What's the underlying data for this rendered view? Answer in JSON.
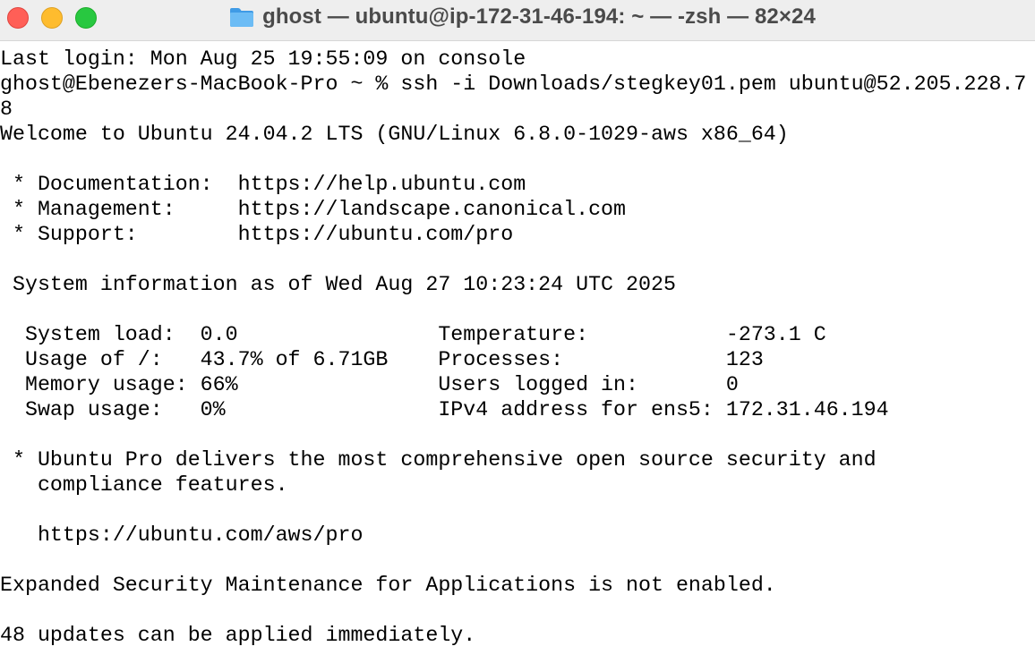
{
  "window": {
    "title": "ghost — ubuntu@ip-172-31-46-194: ~ — -zsh — 82×24",
    "icon": "folder-icon",
    "colors": {
      "close": "#ff5f57",
      "minimize": "#febc2e",
      "maximize": "#28c840",
      "folder": "#5fb3f2"
    }
  },
  "terminal": {
    "lines": [
      "Last login: Mon Aug 25 19:55:09 on console",
      "ghost@Ebenezers-MacBook-Pro ~ % ssh -i Downloads/stegkey01.pem ubuntu@52.205.228.7",
      "8",
      "Welcome to Ubuntu 24.04.2 LTS (GNU/Linux 6.8.0-1029-aws x86_64)",
      "",
      " * Documentation:  https://help.ubuntu.com",
      " * Management:     https://landscape.canonical.com",
      " * Support:        https://ubuntu.com/pro",
      "",
      " System information as of Wed Aug 27 10:23:24 UTC 2025",
      "",
      "  System load:  0.0                Temperature:           -273.1 C",
      "  Usage of /:   43.7% of 6.71GB    Processes:             123",
      "  Memory usage: 66%                Users logged in:       0",
      "  Swap usage:   0%                 IPv4 address for ens5: 172.31.46.194",
      "",
      " * Ubuntu Pro delivers the most comprehensive open source security and",
      "   compliance features.",
      "",
      "   https://ubuntu.com/aws/pro",
      "",
      "Expanded Security Maintenance for Applications is not enabled.",
      "",
      "48 updates can be applied immediately."
    ]
  }
}
